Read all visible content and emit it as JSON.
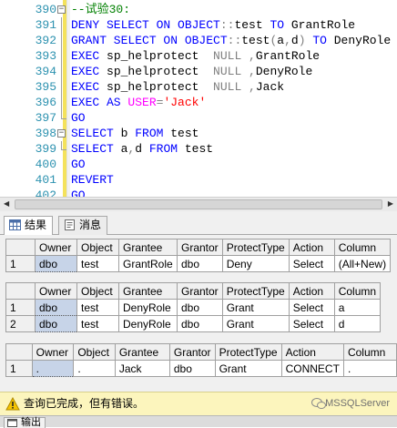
{
  "editor": {
    "lines": [
      {
        "n": "390",
        "tokens": [
          {
            "t": "--试验30:",
            "c": "cm"
          }
        ]
      },
      {
        "n": "391",
        "tokens": [
          {
            "t": "DENY SELECT ON OBJECT",
            "c": "kw"
          },
          {
            "t": "::",
            "c": "gr"
          },
          {
            "t": "test ",
            "c": "tx"
          },
          {
            "t": "TO",
            "c": "kw"
          },
          {
            "t": " GrantRole",
            "c": "tx"
          }
        ]
      },
      {
        "n": "392",
        "tokens": [
          {
            "t": "GRANT SELECT ON OBJECT",
            "c": "kw"
          },
          {
            "t": "::",
            "c": "gr"
          },
          {
            "t": "test",
            "c": "tx"
          },
          {
            "t": "(",
            "c": "gr"
          },
          {
            "t": "a",
            "c": "tx"
          },
          {
            "t": ",",
            "c": "gr"
          },
          {
            "t": "d",
            "c": "tx"
          },
          {
            "t": ")",
            "c": "gr"
          },
          {
            "t": " TO",
            "c": "kw"
          },
          {
            "t": " DenyRole",
            "c": "tx"
          }
        ]
      },
      {
        "n": "393",
        "tokens": [
          {
            "t": "EXEC",
            "c": "kw"
          },
          {
            "t": " sp_helprotect  ",
            "c": "tx"
          },
          {
            "t": "NULL ,",
            "c": "gr"
          },
          {
            "t": "GrantRole",
            "c": "tx"
          }
        ]
      },
      {
        "n": "394",
        "tokens": [
          {
            "t": "EXEC",
            "c": "kw"
          },
          {
            "t": " sp_helprotect  ",
            "c": "tx"
          },
          {
            "t": "NULL ,",
            "c": "gr"
          },
          {
            "t": "DenyRole",
            "c": "tx"
          }
        ]
      },
      {
        "n": "395",
        "tokens": [
          {
            "t": "EXEC",
            "c": "kw"
          },
          {
            "t": " sp_helprotect  ",
            "c": "tx"
          },
          {
            "t": "NULL ,",
            "c": "gr"
          },
          {
            "t": "Jack",
            "c": "tx"
          }
        ]
      },
      {
        "n": "396",
        "tokens": [
          {
            "t": "EXEC AS ",
            "c": "kw"
          },
          {
            "t": "USER",
            "c": "mg"
          },
          {
            "t": "=",
            "c": "gr"
          },
          {
            "t": "'Jack'",
            "c": "st"
          }
        ]
      },
      {
        "n": "397",
        "tokens": [
          {
            "t": "GO",
            "c": "kw"
          }
        ]
      },
      {
        "n": "398",
        "tokens": [
          {
            "t": "SELECT",
            "c": "kw"
          },
          {
            "t": " b ",
            "c": "tx"
          },
          {
            "t": "FROM",
            "c": "kw"
          },
          {
            "t": " test",
            "c": "tx"
          }
        ]
      },
      {
        "n": "399",
        "tokens": [
          {
            "t": "SELECT",
            "c": "kw"
          },
          {
            "t": " a",
            "c": "tx"
          },
          {
            "t": ",",
            "c": "gr"
          },
          {
            "t": "d ",
            "c": "tx"
          },
          {
            "t": "FROM",
            "c": "kw"
          },
          {
            "t": " test",
            "c": "tx"
          }
        ]
      },
      {
        "n": "400",
        "tokens": [
          {
            "t": "GO",
            "c": "kw"
          }
        ]
      },
      {
        "n": "401",
        "tokens": [
          {
            "t": "REVERT",
            "c": "kw"
          }
        ]
      },
      {
        "n": "402",
        "tokens": [
          {
            "t": "GO",
            "c": "kw"
          }
        ]
      }
    ]
  },
  "tabs": {
    "results_label": "结果",
    "messages_label": "消息"
  },
  "grids": [
    {
      "columns": [
        "Owner",
        "Object",
        "Grantee",
        "Grantor",
        "ProtectType",
        "Action",
        "Column"
      ],
      "rows": [
        {
          "num": "1",
          "cells": [
            "dbo",
            "test",
            "GrantRole",
            "dbo",
            "Deny",
            "Select",
            "(All+New)"
          ]
        }
      ]
    },
    {
      "columns": [
        "Owner",
        "Object",
        "Grantee",
        "Grantor",
        "ProtectType",
        "Action",
        "Column"
      ],
      "rows": [
        {
          "num": "1",
          "cells": [
            "dbo",
            "test",
            "DenyRole",
            "dbo",
            "Grant",
            "Select",
            "a"
          ]
        },
        {
          "num": "2",
          "cells": [
            "dbo",
            "test",
            "DenyRole",
            "dbo",
            "Grant",
            "Select",
            "d"
          ]
        }
      ]
    },
    {
      "columns": [
        "Owner",
        "Object",
        "Grantee",
        "Grantor",
        "ProtectType",
        "Action",
        "Column"
      ],
      "rows": [
        {
          "num": "1",
          "cells": [
            ".",
            ".",
            "Jack",
            "dbo",
            "Grant",
            "CONNECT",
            "."
          ]
        }
      ]
    }
  ],
  "status": {
    "message": "查询已完成，但有错误。",
    "watermark": "MSSQLServer"
  },
  "bottom": {
    "output_label": "输出"
  },
  "colors": {
    "keyword": "#0000ff",
    "comment": "#008000",
    "operator": "#808080",
    "function": "#ff00ff",
    "string": "#ff0000",
    "line_number": "#2b91af",
    "status_bg": "#fcf5bd",
    "selected_cell": "#c7d4e8"
  }
}
